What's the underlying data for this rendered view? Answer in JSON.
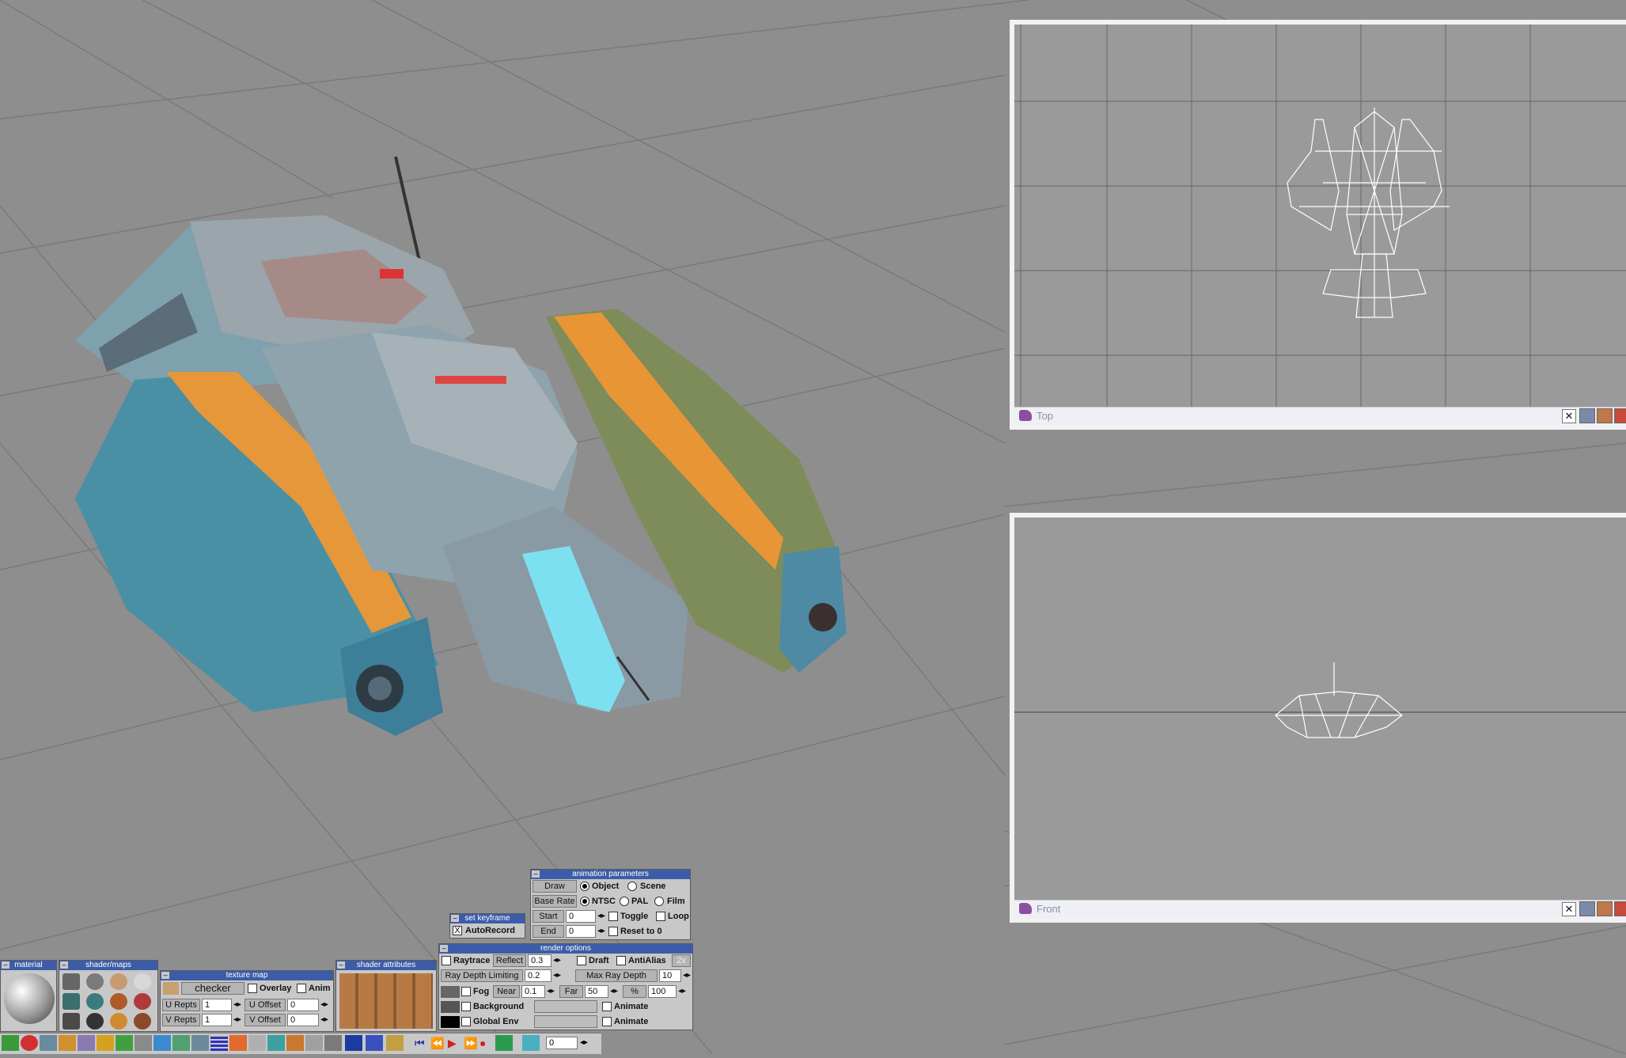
{
  "colors": {
    "bg": "#8e8e8e",
    "grid": "#7c7c7c",
    "panel": "#c8c8c8",
    "header": "#3c5ca8",
    "wire": "#ffffff"
  },
  "viewports": {
    "top": {
      "label": "Top",
      "close": "✕"
    },
    "front": {
      "label": "Front",
      "close": "✕"
    }
  },
  "material": {
    "title": "material",
    "icon": "sphere-icon"
  },
  "shader_maps": {
    "title": "shader/maps"
  },
  "texture_map": {
    "title": "texture map",
    "map_name": "checker",
    "overlay": "Overlay",
    "anim": "Anim",
    "u_repts_label": "U Repts",
    "u_repts": "1",
    "v_repts_label": "V Repts",
    "v_repts": "1",
    "u_offset_label": "U Offset",
    "u_offset": "0",
    "v_offset_label": "V Offset",
    "v_offset": "0"
  },
  "shader_attributes": {
    "title": "shader attributes"
  },
  "set_keyframe": {
    "title": "set keyframe",
    "autorecord": "AutoRecord",
    "checked": "X"
  },
  "animation": {
    "title": "animation parameters",
    "draw": "Draw",
    "object": "Object",
    "scene": "Scene",
    "base_rate": "Base Rate",
    "ntsc": "NTSC",
    "pal": "PAL",
    "film": "Film",
    "start_label": "Start",
    "start": "0",
    "end_label": "End",
    "end": "0",
    "toggle": "Toggle",
    "loop": "Loop",
    "reset": "Reset to 0"
  },
  "render": {
    "title": "render options",
    "raytrace": "Raytrace",
    "reflect": "Reflect",
    "reflect_val": "0.3",
    "draft": "Draft",
    "antialias": "AntiAlias",
    "aa_val": "2x",
    "ray_depth_limiting": "Ray Depth Limiting",
    "rdl_val": "0.2",
    "max_ray_depth": "Max Ray Depth",
    "mrd_val": "10",
    "fog": "Fog",
    "near": "Near",
    "near_val": "0.1",
    "far": "Far",
    "far_val": "50",
    "pct": "%",
    "pct_val": "100",
    "background": "Background",
    "animate": "Animate",
    "global_env": "Global Env",
    "animate2": "Animate"
  },
  "timeline": {
    "frame": "0"
  }
}
